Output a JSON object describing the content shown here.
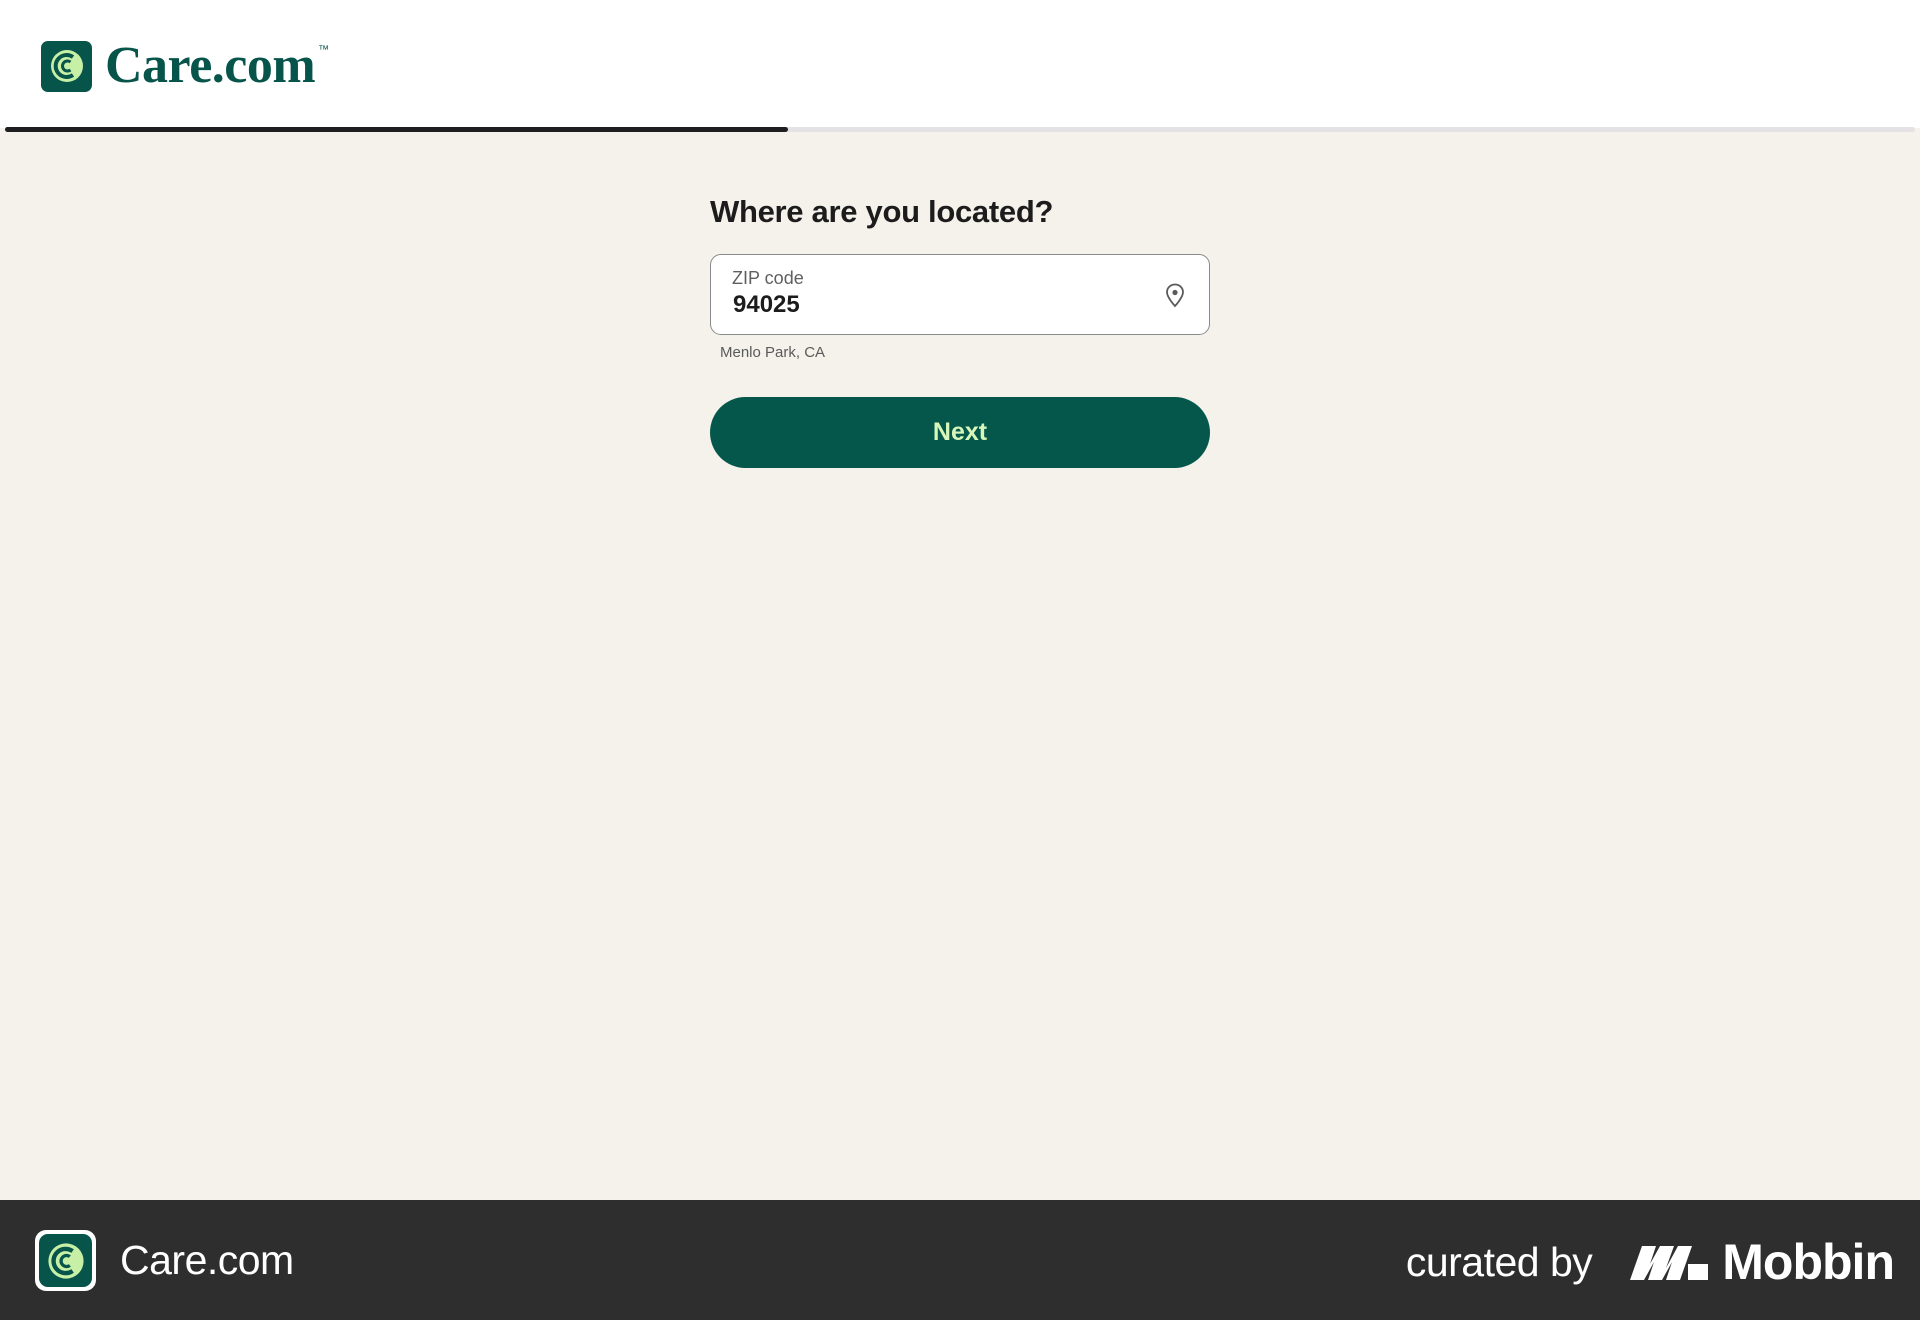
{
  "header": {
    "brand": "Care.com",
    "trademark": "™"
  },
  "progress": {
    "fraction": 0.41
  },
  "form": {
    "question": "Where are you located?",
    "zip_label": "ZIP code",
    "zip_value": "94025",
    "location_hint": "Menlo Park, CA",
    "next_label": "Next"
  },
  "footer": {
    "app_name": "Care.com",
    "curated_label": "curated by",
    "mobbin_label": "Mobbin"
  },
  "colors": {
    "brand_green": "#06544a",
    "button_text": "#d6f7b9",
    "background": "#f5f2ec"
  },
  "icons": {
    "logo": "care-logo-icon",
    "pin": "map-pin-icon",
    "mobbin": "mobbin-logo-icon"
  }
}
